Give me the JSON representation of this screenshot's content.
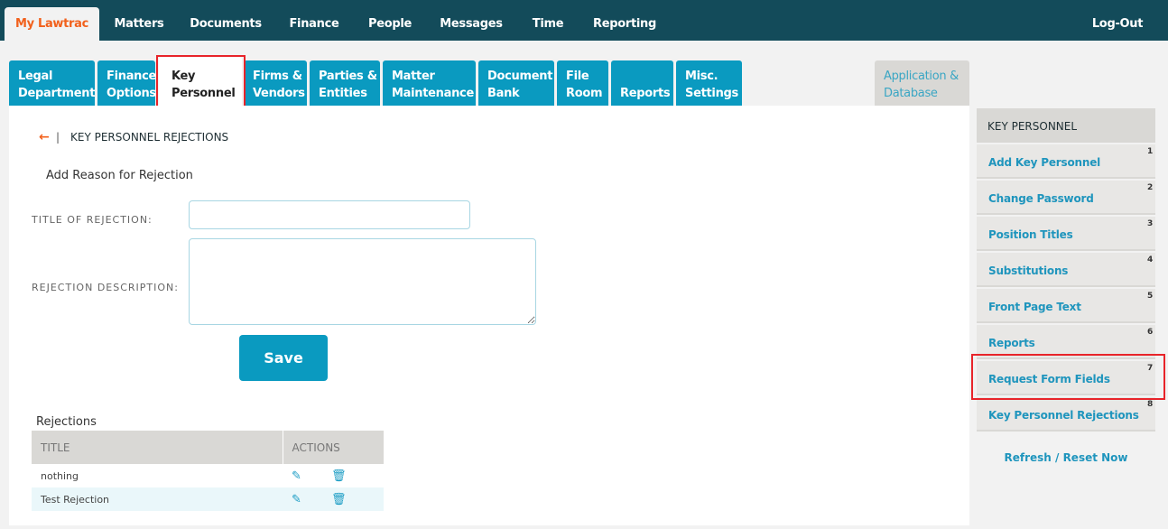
{
  "topnav": {
    "items": [
      "My Lawtrac",
      "Matters",
      "Documents",
      "Finance",
      "People",
      "Messages",
      "Time",
      "Reporting"
    ],
    "logout": "Log-Out"
  },
  "tabs": [
    [
      "Legal",
      "Department"
    ],
    [
      "Finance",
      "Options"
    ],
    [
      "Key",
      "Personnel"
    ],
    [
      "Firms &",
      "Vendors"
    ],
    [
      "Parties &",
      "Entities"
    ],
    [
      "Matter",
      "Maintenance"
    ],
    [
      "Document",
      "Bank"
    ],
    [
      "File",
      "Room"
    ],
    [
      "",
      "Reports"
    ],
    [
      "Misc.",
      "Settings"
    ]
  ],
  "app_tab": [
    "Application &",
    "Database"
  ],
  "breadcrumb": {
    "separator": "|",
    "title": "KEY PERSONNEL REJECTIONS"
  },
  "form": {
    "heading": "Add Reason for Rejection",
    "title_label": "TITLE OF REJECTION:",
    "title_value": "",
    "desc_label": "REJECTION DESCRIPTION:",
    "desc_value": "",
    "save": "Save"
  },
  "rejections": {
    "heading": "Rejections",
    "columns": [
      "TITLE",
      "ACTIONS"
    ],
    "rows": [
      "nothing",
      "Test Rejection"
    ]
  },
  "sidebar": {
    "heading": "KEY PERSONNEL",
    "items": [
      {
        "label": "Add Key Personnel",
        "num": "1"
      },
      {
        "label": "Change Password",
        "num": "2"
      },
      {
        "label": "Position Titles",
        "num": "3"
      },
      {
        "label": "Substitutions",
        "num": "4"
      },
      {
        "label": "Front Page Text",
        "num": "5"
      },
      {
        "label": "Reports",
        "num": "6"
      },
      {
        "label": "Request Form Fields",
        "num": "7"
      },
      {
        "label": "Key Personnel Rejections",
        "num": "8"
      }
    ],
    "refresh": "Refresh / Reset Now"
  },
  "colors": {
    "topbar": "#134b5a",
    "accent": "#0a9ac0",
    "active_nav": "#f2601b",
    "highlight": "#e8242a"
  }
}
